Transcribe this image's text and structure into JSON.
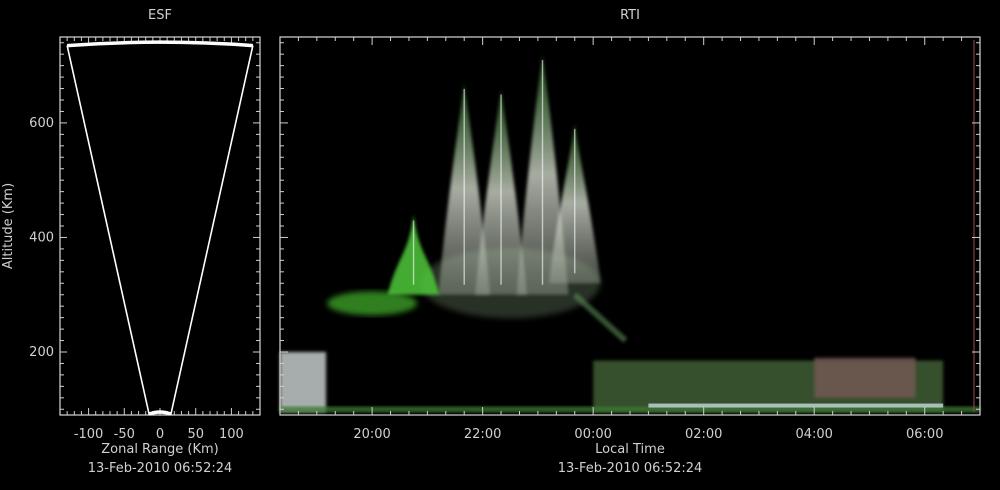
{
  "colors": {
    "background": "#000000",
    "axis": "#d0d0d0",
    "echo_green": "#4fc83a",
    "echo_white": "#e8efe0"
  },
  "chart_data": [
    {
      "type": "scatter",
      "title": "ESF",
      "xlabel": "Zonal Range (Km)",
      "ylabel": "Altitude (Km)",
      "timestamp": "13-Feb-2010 06:52:24",
      "xlim": [
        -140,
        140
      ],
      "ylim": [
        90,
        750
      ],
      "xticks": [
        -100,
        -50,
        0,
        50,
        100
      ],
      "yticks": [
        200,
        400,
        600
      ],
      "beam_edges": [
        {
          "x": [
            -130,
            -15
          ],
          "y": [
            735,
            90
          ]
        },
        {
          "x": [
            130,
            15
          ],
          "y": [
            735,
            90
          ]
        }
      ],
      "top_arc_altitude": 740,
      "bottom_arc_altitude": 90
    },
    {
      "type": "heatmap",
      "title": "RTI",
      "xlabel": "Local Time",
      "ylabel": "",
      "timestamp": "13-Feb-2010 06:52:24",
      "xlim": [
        "18:20",
        "07:00"
      ],
      "ylim": [
        90,
        750
      ],
      "xticks": [
        "20:00",
        "22:00",
        "00:00",
        "02:00",
        "04:00",
        "06:00"
      ],
      "yticks": [
        200,
        400,
        600
      ],
      "plumes": [
        {
          "time": "21:40",
          "top": 670,
          "bottom": 300,
          "color": "#e8efe0"
        },
        {
          "time": "22:20",
          "top": 660,
          "bottom": 300,
          "color": "#e8efe0"
        },
        {
          "time": "23:05",
          "top": 720,
          "bottom": 300,
          "color": "#e8efe0"
        },
        {
          "time": "23:40",
          "top": 600,
          "bottom": 320,
          "color": "#d8e8c8"
        },
        {
          "time": "20:45",
          "top": 440,
          "bottom": 300,
          "color": "#4fc83a"
        }
      ],
      "bottom_layers": [
        {
          "start": "18:20",
          "end": "19:10",
          "top": 200,
          "bottom": 95,
          "color": "#dfe6e6"
        },
        {
          "start": "00:00",
          "end": "06:20",
          "top": 185,
          "bottom": 95,
          "color": "#4a6a3a"
        },
        {
          "start": "04:00",
          "end": "05:50",
          "top": 190,
          "bottom": 120,
          "color": "#7a5a5a"
        }
      ]
    }
  ]
}
